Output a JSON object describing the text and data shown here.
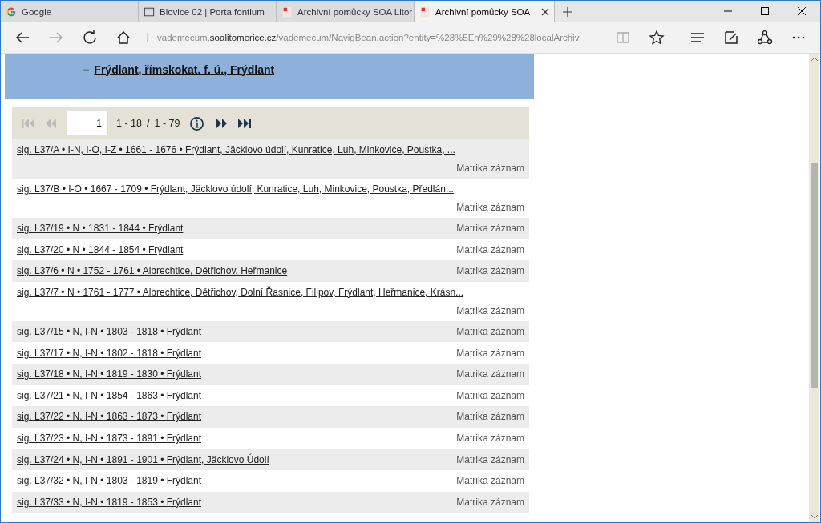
{
  "tabs": [
    {
      "label": "Google",
      "selected": false
    },
    {
      "label": "Blovice 02 | Porta fontium",
      "selected": false
    },
    {
      "label": "Archivní pomůcky SOA Litor",
      "selected": false
    },
    {
      "label": "Archivní pomůcky SOA",
      "selected": true
    }
  ],
  "address": {
    "prefix": "vademecum.",
    "host": "soalitomerice.cz",
    "path": "/vademecum/NavigBean.action?entity=%28%5En%29%28%28localArchiv"
  },
  "header": {
    "link": "Frýdlant, římskokat. f. ú., Frýdlant",
    "dash": "–"
  },
  "pager": {
    "page": "1",
    "range": "1 - 18",
    "separator": "/",
    "total": "1 - 79",
    "first_disabled": true,
    "prev_disabled": true
  },
  "rows": [
    {
      "text": "sig. L37/A • I-N, I-O, I-Z • 1661 - 1676 • Frýdlant, Jäcklovo údolí, Kunratice, Luh, Minkovice, Poustka, ...",
      "action": "Matrika záznam",
      "kind": "wrapped"
    },
    {
      "text": "sig. L37/B • I-O • 1667 - 1709 • Frýdlant, Jäcklovo údolí, Kunratice, Luh, Minkovice, Poustka, Předlán...",
      "action": "Matrika záznam",
      "kind": "wrapped"
    },
    {
      "text": "sig. L37/19 • N • 1831 - 1844 • Frýdlant",
      "action": "Matrika záznam",
      "kind": "inline"
    },
    {
      "text": "sig. L37/20 • N • 1844 - 1854 • Frýdlant",
      "action": "Matrika záznam",
      "kind": "inline"
    },
    {
      "text": "sig. L37/6 • N • 1752 - 1761 • Albrechtice, Dětřichov, Heřmanice",
      "action": "Matrika záznam",
      "kind": "inline"
    },
    {
      "text": "sig. L37/7 • N • 1761 - 1777 • Albrechtice, Dětřichov, Dolní Řasnice, Filipov, Frýdlant, Heřmanice, Krásn...",
      "action": "Matrika záznam",
      "kind": "wrapped"
    },
    {
      "text": "sig. L37/15 • N, I-N • 1803 - 1818 • Frýdlant",
      "action": "Matrika záznam",
      "kind": "inline"
    },
    {
      "text": "sig. L37/17 • N, I-N • 1802 - 1818 • Frýdlant",
      "action": "Matrika záznam",
      "kind": "inline"
    },
    {
      "text": "sig. L37/18 • N, I-N • 1819 - 1830 • Frýdlant",
      "action": "Matrika záznam",
      "kind": "inline"
    },
    {
      "text": "sig. L37/21 • N, I-N • 1854 - 1863 • Frýdlant",
      "action": "Matrika záznam",
      "kind": "inline"
    },
    {
      "text": "sig. L37/22 • N, I-N • 1863 - 1873 • Frýdlant",
      "action": "Matrika záznam",
      "kind": "inline"
    },
    {
      "text": "sig. L37/23 • N, I-N • 1873 - 1891 • Frýdlant",
      "action": "Matrika záznam",
      "kind": "inline"
    },
    {
      "text": "sig. L37/24 • N, I-N • 1891 - 1901 • Frýdlant, Jäcklovo Údolí",
      "action": "Matrika záznam",
      "kind": "inline"
    },
    {
      "text": "sig. L37/32 • N, I-N • 1803 - 1819 • Frýdlant",
      "action": "Matrika záznam",
      "kind": "inline"
    },
    {
      "text": "sig. L37/33 • N, I-N • 1819 - 1853 • Frýdlant",
      "action": "Matrika záznam",
      "kind": "inline"
    }
  ]
}
